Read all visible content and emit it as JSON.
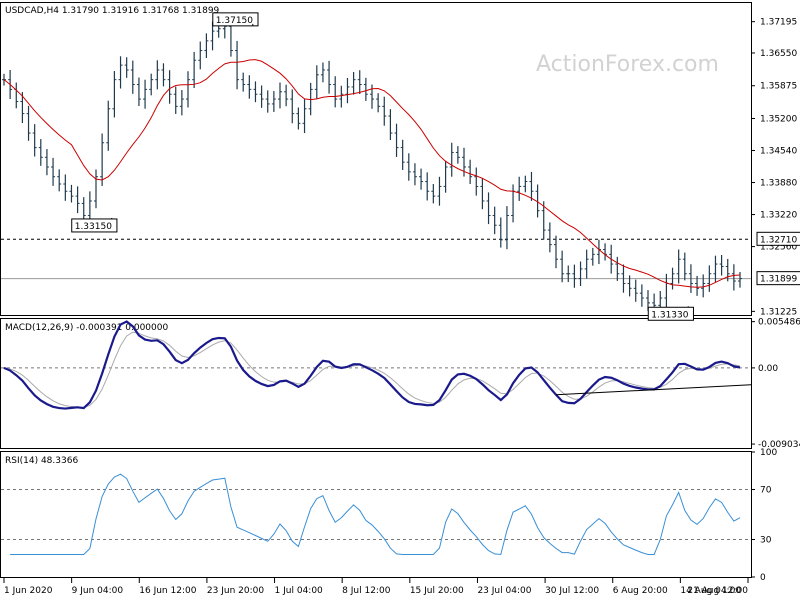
{
  "chart_data": [
    {
      "type": "candlestick",
      "title": "USDCAD,H4  1.31790 1.31916 1.31768 1.31899",
      "watermark": "ActionForex.com",
      "ylim": [
        1.3115,
        1.3758
      ],
      "y_ticks": [
        "1.37195",
        "1.36550",
        "1.35875",
        "1.35200",
        "1.34540",
        "1.33880",
        "1.33220",
        "1.32560",
        "1.31225"
      ],
      "y_tick_values": [
        1.37195,
        1.3655,
        1.35875,
        1.352,
        1.3454,
        1.3388,
        1.3322,
        1.3256,
        1.31225
      ],
      "x_tick_labels": [
        "1 Jun 2020",
        "9 Jun 04:00",
        "16 Jun 12:00",
        "23 Jun 20:00",
        "1 Jul 04:00",
        "8 Jul 12:00",
        "15 Jul 20:00",
        "23 Jul 04:00",
        "30 Jul 12:00",
        "6 Aug 20:00",
        "14 Aug 04:00",
        "21 Aug 12:00"
      ],
      "current_price": {
        "label": "1.31899",
        "value": 1.31899
      },
      "level_line": {
        "label": "1.32710",
        "value": 1.3271,
        "style": "dashed"
      },
      "annotations": [
        {
          "label": "1.37150",
          "value": 1.3715,
          "bar": 36
        },
        {
          "label": "1.33150",
          "value": 1.3315,
          "bar": 13
        },
        {
          "label": "1.31330",
          "value": 1.3133,
          "bar": 107
        }
      ],
      "series": [
        {
          "name": "SMA 55",
          "color": "#cc0000"
        }
      ],
      "bar_color": "#1f3a4d",
      "grid": false
    },
    {
      "type": "line",
      "title": "MACD(12,26,9) -0.000391 0.000000",
      "ylim": [
        -0.0095,
        0.0058
      ],
      "y_ticks": [
        "0.005486",
        "0.00",
        "-0.009034"
      ],
      "y_tick_values": [
        0.005486,
        0.0,
        -0.009034
      ],
      "zero_line": "dashed",
      "series": [
        {
          "name": "MACD",
          "color": "#1a1a8c"
        },
        {
          "name": "Signal",
          "color": "#aaaaaa"
        }
      ],
      "trendline": {
        "color": "#000000",
        "from_bar": 90,
        "to_bar": 124
      }
    },
    {
      "type": "line",
      "title": "RSI(14) 48.3366",
      "ylim": [
        0,
        100
      ],
      "y_ticks": [
        "100",
        "70",
        "30",
        "0"
      ],
      "y_tick_values": [
        100,
        70,
        30,
        0
      ],
      "levels": [
        70,
        30
      ],
      "series": [
        {
          "name": "RSI",
          "color": "#3a8fd6"
        }
      ]
    }
  ],
  "price_path": [
    1.36,
    1.358,
    1.3555,
    1.353,
    1.349,
    1.346,
    1.344,
    1.342,
    1.34,
    1.3385,
    1.337,
    1.336,
    1.3345,
    1.332,
    1.335,
    1.34,
    1.347,
    1.354,
    1.36,
    1.363,
    1.362,
    1.359,
    1.356,
    1.358,
    1.36,
    1.362,
    1.36,
    1.357,
    1.3545,
    1.356,
    1.36,
    1.364,
    1.366,
    1.368,
    1.37,
    1.3705,
    1.371,
    1.366,
    1.36,
    1.359,
    1.358,
    1.357,
    1.356,
    1.355,
    1.356,
    1.3575,
    1.356,
    1.353,
    1.351,
    1.354,
    1.358,
    1.361,
    1.362,
    1.359,
    1.356,
    1.357,
    1.3585,
    1.36,
    1.359,
    1.357,
    1.356,
    1.3545,
    1.3525,
    1.349,
    1.346,
    1.343,
    1.341,
    1.34,
    1.339,
    1.337,
    1.336,
    1.338,
    1.342,
    1.345,
    1.344,
    1.342,
    1.34,
    1.338,
    1.335,
    1.332,
    1.33,
    1.327,
    1.332,
    1.337,
    1.338,
    1.339,
    1.337,
    1.333,
    1.329,
    1.326,
    1.323,
    1.32,
    1.32,
    1.319,
    1.321,
    1.323,
    1.324,
    1.325,
    1.324,
    1.322,
    1.32,
    1.318,
    1.317,
    1.316,
    1.315,
    1.314,
    1.3135,
    1.315,
    1.318,
    1.32,
    1.323,
    1.32,
    1.318,
    1.317,
    1.318,
    1.32,
    1.322,
    1.3215,
    1.32,
    1.3185,
    1.319
  ]
}
